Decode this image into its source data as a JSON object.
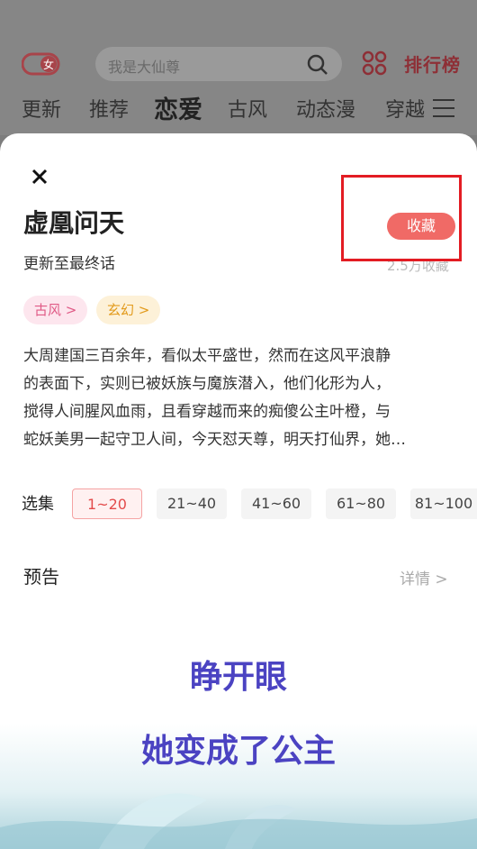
{
  "header": {
    "logo_text": "女",
    "search_placeholder": "我是大仙尊",
    "rank_label": "排行榜",
    "tabs": [
      "更新",
      "推荐",
      "恋爱",
      "古风",
      "动态漫",
      "穿越"
    ]
  },
  "sheet": {
    "title": "虚凰问天",
    "update_status": "更新至最终话",
    "favorite_label": "收藏",
    "favorite_count": "2.5万收藏",
    "tags": [
      "古风 >",
      "玄幻 >"
    ],
    "description_lines": [
      "大周建国三百余年，看似太平盛世，然而在这风平浪静",
      "的表面下，实则已被妖族与魔族潜入，他们化形为人，",
      "搅得人间腥风血雨，且看穿越而来的痴傻公主叶橙，与",
      "蛇妖美男一起守卫人间，今天怼天尊，明天打仙界，她…"
    ],
    "episodes_label": "选集",
    "episode_ranges": [
      "1~20",
      "21~40",
      "41~60",
      "61~80",
      "81~100"
    ],
    "preview_label": "预告",
    "details_label": "详情 >",
    "video_captions": [
      "睁开眼",
      "她变成了公主"
    ]
  },
  "colors": {
    "accent": "#f06a66",
    "highlight": "#e31c23",
    "caption": "#4b43c2"
  }
}
